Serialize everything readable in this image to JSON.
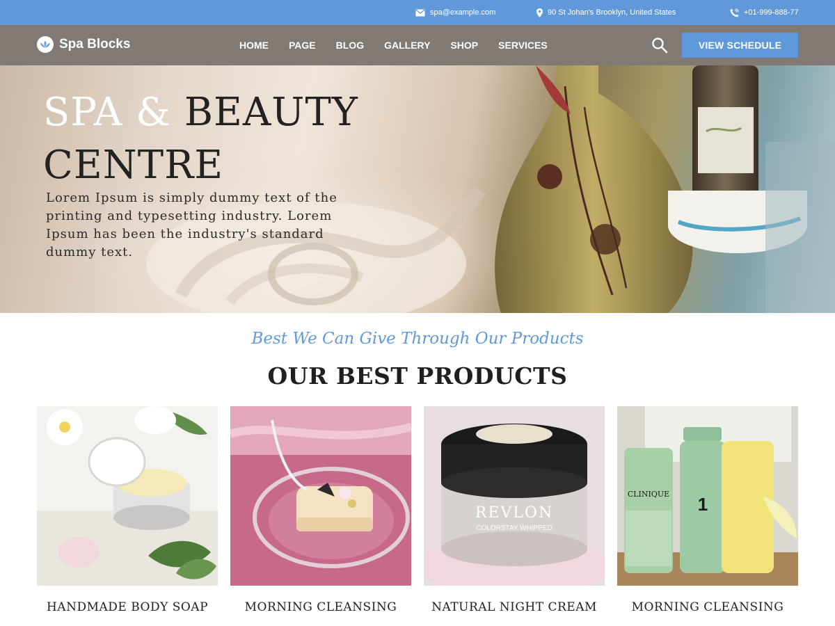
{
  "topbar": {
    "email": "spa@example.com",
    "address": "90 St Johan's Brooklyn, United States",
    "phone": "+01-999-888-77",
    "icons": [
      "mail-icon",
      "location-pin-icon",
      "phone-icon"
    ]
  },
  "header": {
    "logo_text": "Spa Blocks",
    "logo_icon": "lotus-icon",
    "nav": [
      "HOME",
      "PAGE",
      "BLOG",
      "GALLERY",
      "SHOP",
      "SERVICES"
    ],
    "search_icon": "search-icon",
    "cta_label": "VIEW SCHEDULE"
  },
  "hero": {
    "title_light": "SPA &",
    "title_dark_1": "BEAUTY",
    "title_dark_2": "CENTRE",
    "description": "Lorem Ipsum is simply dummy text of the printing and typesetting industry. Lorem Ipsum has been the industry's standard dummy text."
  },
  "products": {
    "subheading": "Best We Can Give Through Our Products",
    "title": "OUR BEST PRODUCTS",
    "items": [
      {
        "name": "HANDMADE BODY SOAP"
      },
      {
        "name": "MORNING CLEANSING"
      },
      {
        "name": "NATURAL NIGHT CREAM"
      },
      {
        "name": "MORNING CLEANSING"
      }
    ],
    "image_text": {
      "revlon_brand": "REVLON",
      "revlon_line": "COLORSTAY WHIPPED",
      "clinique_brand": "CLINIQUE",
      "clinique_number": "1"
    }
  },
  "colors": {
    "accent": "#5f99da",
    "header_bg": "#766e67",
    "heading": "#1f1f1f",
    "white": "#ffffff"
  }
}
